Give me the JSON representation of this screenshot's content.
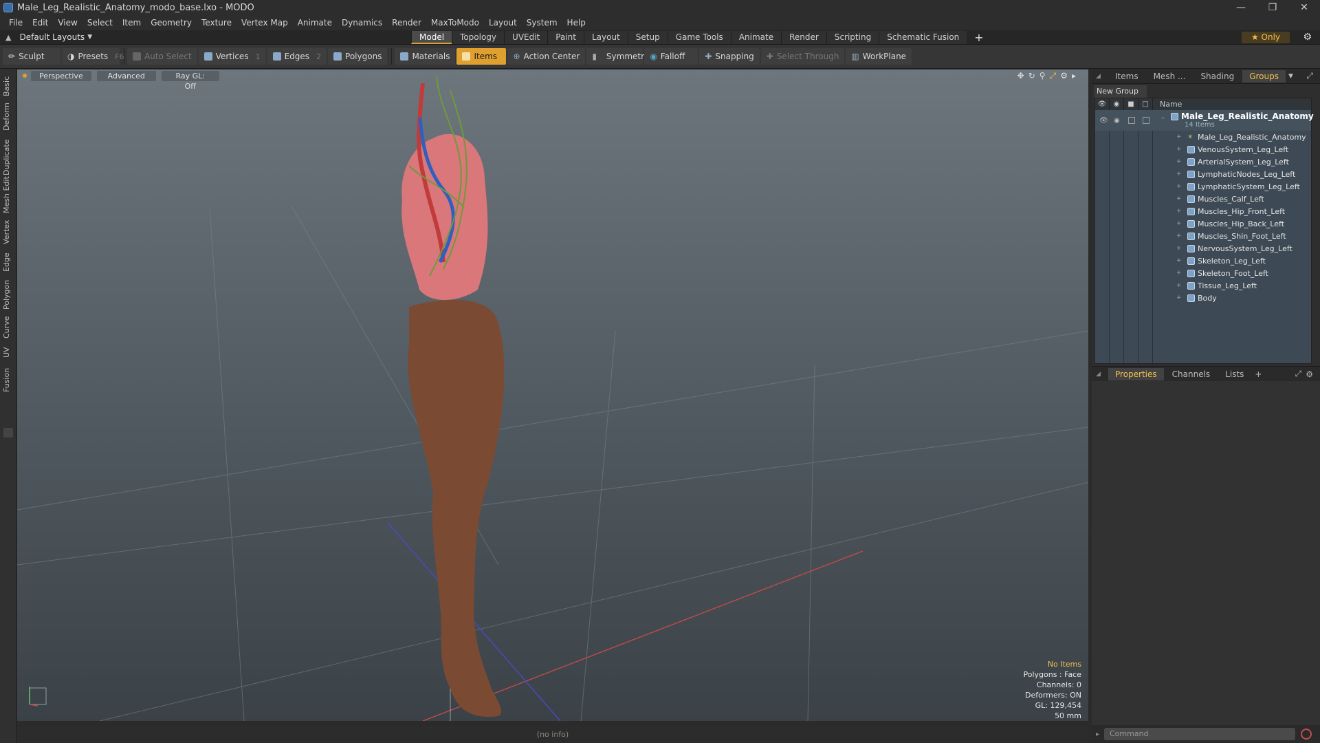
{
  "window": {
    "title": "Male_Leg_Realistic_Anatomy_modo_base.lxo - MODO"
  },
  "menu": [
    "File",
    "Edit",
    "View",
    "Select",
    "Item",
    "Geometry",
    "Texture",
    "Vertex Map",
    "Animate",
    "Dynamics",
    "Render",
    "MaxToModo",
    "Layout",
    "System",
    "Help"
  ],
  "layout_selector": "Default Layouts",
  "tabs": [
    "Model",
    "Topology",
    "UVEdit",
    "Paint",
    "Layout",
    "Setup",
    "Game Tools",
    "Animate",
    "Render",
    "Scripting",
    "Schematic Fusion"
  ],
  "active_tab": "Model",
  "only_label": "Only",
  "toolbar": {
    "sculpt": "Sculpt",
    "presets": "Presets",
    "presets_key": "F6",
    "auto_select": "Auto Select",
    "vertices": "Vertices",
    "vertices_key": "1",
    "edges": "Edges",
    "edges_key": "2",
    "polygons": "Polygons",
    "materials": "Materials",
    "items": "Items",
    "action_center": "Action Center",
    "symmetry": "Symmetry",
    "falloff": "Falloff",
    "snapping": "Snapping",
    "select_through": "Select Through",
    "workplane": "WorkPlane"
  },
  "left_tabs": [
    "Basic",
    "Deform",
    "Duplicate",
    "Mesh Edit",
    "Vertex",
    "Edge",
    "Polygon",
    "Curve",
    "UV",
    "Fusion"
  ],
  "viewport": {
    "perspective": "Perspective",
    "advanced": "Advanced",
    "raygl": "Ray GL: Off",
    "info": [
      "No Items",
      "Polygons : Face",
      "Channels: 0",
      "Deformers: ON",
      "GL: 129,454",
      "50 mm"
    ]
  },
  "status": "(no info)",
  "right_tabs": [
    "Items",
    "Mesh ...",
    "Shading",
    "Groups"
  ],
  "active_right_tab": "Groups",
  "groups": {
    "new_group": "New Group",
    "name_header": "Name",
    "root": {
      "name": "Male_Leg_Realistic_Anatomy",
      "count": "14 Items"
    },
    "items": [
      {
        "name": "Male_Leg_Realistic_Anatomy",
        "type": "locator"
      },
      {
        "name": "VenousSystem_Leg_Left",
        "type": "mesh"
      },
      {
        "name": "ArterialSystem_Leg_Left",
        "type": "mesh"
      },
      {
        "name": "LymphaticNodes_Leg_Left",
        "type": "mesh"
      },
      {
        "name": "LymphaticSystem_Leg_Left",
        "type": "mesh"
      },
      {
        "name": "Muscles_Calf_Left",
        "type": "mesh"
      },
      {
        "name": "Muscles_Hip_Front_Left",
        "type": "mesh"
      },
      {
        "name": "Muscles_Hip_Back_Left",
        "type": "mesh"
      },
      {
        "name": "Muscles_Shin_Foot_Left",
        "type": "mesh"
      },
      {
        "name": "NervousSystem_Leg_Left",
        "type": "mesh"
      },
      {
        "name": "Skeleton_Leg_Left",
        "type": "mesh"
      },
      {
        "name": "Skeleton_Foot_Left",
        "type": "mesh"
      },
      {
        "name": "Tissue_Leg_Left",
        "type": "mesh"
      },
      {
        "name": "Body",
        "type": "mesh"
      }
    ]
  },
  "prop_tabs": [
    "Properties",
    "Channels",
    "Lists"
  ],
  "command_placeholder": "Command",
  "colors": {
    "accent": "#e0a030",
    "skin": "#7a4a33",
    "muscle": "#d9777a",
    "vein": "#2f5fc0",
    "artery": "#c23b3b",
    "lymph": "#6f9a3a"
  }
}
